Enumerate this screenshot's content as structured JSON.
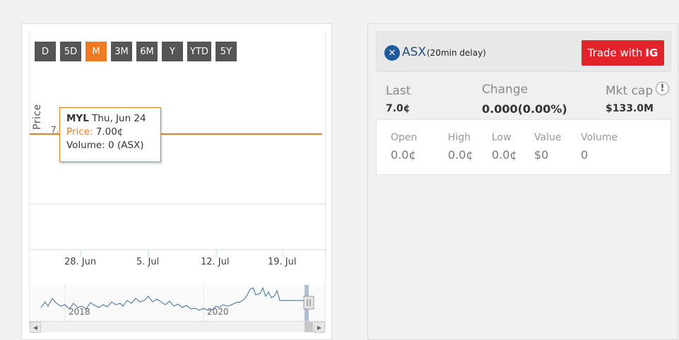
{
  "chart": {
    "ranges": [
      "D",
      "5D",
      "M",
      "3M",
      "6M",
      "Y",
      "YTD",
      "5Y"
    ],
    "active_range": "M",
    "y_axis_title": "Price",
    "y_tick_partial": "7.",
    "x_ticks": [
      "28. Jun",
      "5. Jul",
      "12. Jul",
      "19. Jul"
    ],
    "navigator_years": [
      "2018",
      "2020"
    ],
    "line_color": "#ef7a22",
    "tooltip": {
      "symbol": "MYL",
      "date": "Thu, Jun 24",
      "price_label": "Price:",
      "price_value": "7.00¢",
      "volume": "Volume: 0 (ASX)"
    }
  },
  "chart_data": {
    "type": "line",
    "series": [
      {
        "values": [
          7.0,
          7.0,
          7.0,
          7.0,
          7.0
        ]
      }
    ],
    "x": [
      "28. Jun",
      "5. Jul",
      "12. Jul",
      "19. Jul"
    ],
    "ylabel": "Price"
  },
  "quote": {
    "exchange": "ASX",
    "delay": "(20min delay)",
    "trade_label": "Trade with",
    "trade_brand": "IG",
    "trade_color": "#e3222b",
    "last_label": "Last",
    "last_value": "7.0¢",
    "change_label": "Change",
    "change_value": "0.000(0.00%)",
    "mktcap_label": "Mkt cap",
    "mktcap_value": "$133.0M",
    "info_icon": "!",
    "sub": [
      {
        "label": "Open",
        "value": "0.0¢"
      },
      {
        "label": "High",
        "value": "0.0¢"
      },
      {
        "label": "Low",
        "value": "0.0¢"
      },
      {
        "label": "Value",
        "value": "$0"
      },
      {
        "label": "Volume",
        "value": "0"
      }
    ]
  }
}
